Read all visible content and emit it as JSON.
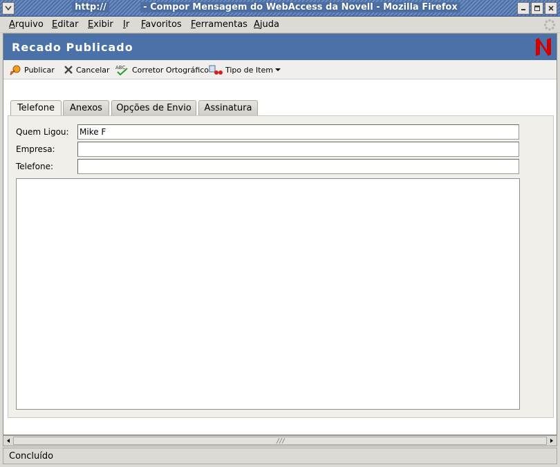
{
  "window": {
    "url_prefix": "http://",
    "title": "- Compor Mensagem do WebAccess da Novell - Mozilla Firefox"
  },
  "menu": [
    "Arquivo",
    "Editar",
    "Exibir",
    "Ir",
    "Favoritos",
    "Ferramentas",
    "Ajuda"
  ],
  "header": {
    "title": "Recado Publicado"
  },
  "toolbar": {
    "publish": "Publicar",
    "cancel": "Cancelar",
    "spell": "Corretor Ortográfico",
    "item_type": "Tipo de Item"
  },
  "tabs": [
    "Telefone",
    "Anexos",
    "Opções de Envio",
    "Assinatura"
  ],
  "form": {
    "caller_label": "Quem Ligou:",
    "caller_value": "Mike F",
    "company_label": "Empresa:",
    "company_value": "",
    "phone_label": "Telefone:",
    "phone_value": ""
  },
  "status": {
    "text": "Concluído"
  },
  "colors": {
    "banner": "#4a72a8",
    "logo": "#d40000"
  }
}
